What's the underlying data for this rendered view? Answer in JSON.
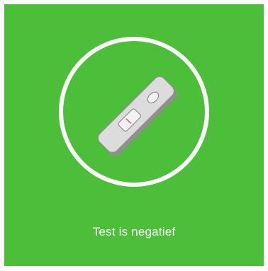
{
  "result": {
    "message": "Test is negatief",
    "icon": "antigen-test-cassette-icon"
  },
  "colors": {
    "panel_background": "#4cbe3a",
    "ring": "#ffffff",
    "text": "#ffffff",
    "test_line": "#e05a6a"
  }
}
